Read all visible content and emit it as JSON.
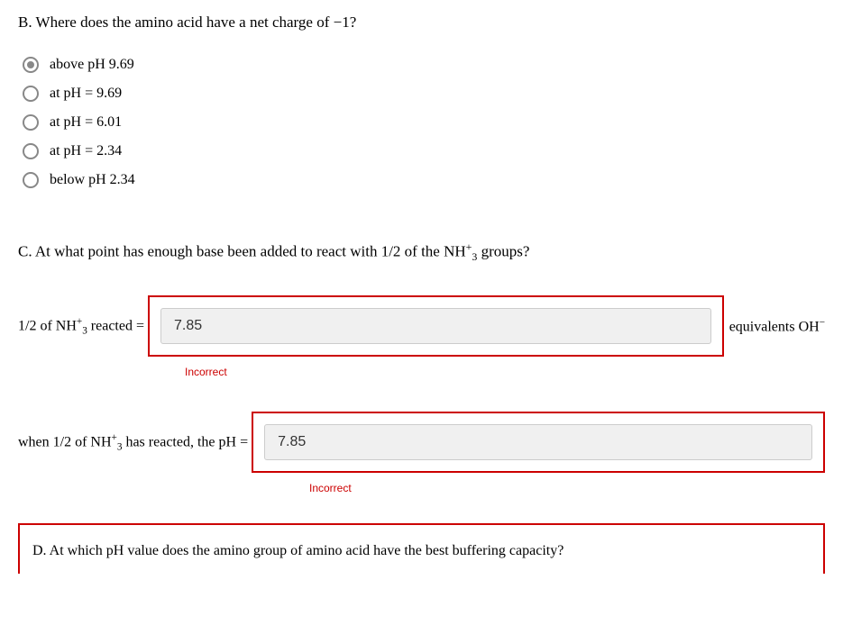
{
  "questionB": {
    "prompt": "B. Where does the amino acid have a net charge of −1?",
    "options": [
      "above pH 9.69",
      "at pH = 9.69",
      "at pH = 6.01",
      "at pH = 2.34",
      "below pH 2.34"
    ],
    "selectedIndex": 0
  },
  "questionC": {
    "prompt_prefix": "C. At what point has enough base been added to react with 1/2 of the NH",
    "prompt_suffix": " groups?",
    "answer1": {
      "label_prefix": "1/2 of NH",
      "label_suffix": " reacted = ",
      "value": "7.85",
      "post_prefix": " equivalents OH",
      "feedback": "Incorrect"
    },
    "answer2": {
      "label_prefix": "when 1/2 of NH",
      "label_suffix": " has reacted, the pH = ",
      "value": "7.85",
      "feedback": "Incorrect"
    }
  },
  "questionD": {
    "prompt": "D. At which pH value does the amino group of amino acid have the best buffering capacity?"
  }
}
